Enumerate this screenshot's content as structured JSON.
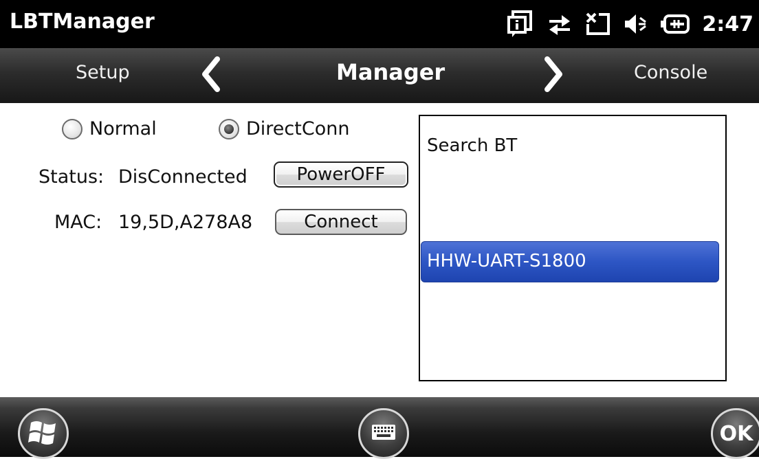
{
  "status_bar": {
    "app_title": "LBTManager",
    "icons": [
      "notification-icon",
      "data-sync-icon",
      "no-signal-icon",
      "volume-icon",
      "battery-charging-icon"
    ],
    "time": "2:47"
  },
  "pivot": {
    "prev_label": "Setup",
    "title": "Manager",
    "next_label": "Console"
  },
  "mode": {
    "options": [
      {
        "label": "Normal",
        "checked": false
      },
      {
        "label": "DirectConn",
        "checked": true
      }
    ]
  },
  "status": {
    "label": "Status:",
    "value": "DisConnected",
    "power_button": "PowerOFF"
  },
  "mac": {
    "label": "MAC:",
    "value": "19,5D,A278A8",
    "connect_button": "Connect"
  },
  "device_list": {
    "header": "Search BT",
    "items": [
      {
        "label": "HHW-UART-S1800",
        "selected": true
      }
    ]
  },
  "bottom_bar": {
    "ok_label": "OK"
  },
  "colors": {
    "selection": "#2d56c4",
    "bar": "#000000"
  }
}
